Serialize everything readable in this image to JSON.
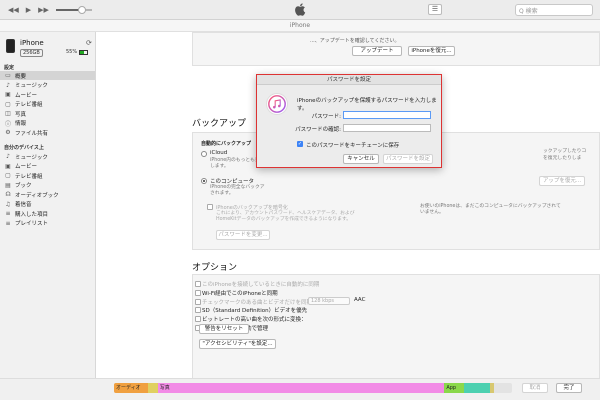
{
  "titlebar": {
    "apple_icon": "apple-logo-icon",
    "search_placeholder": "Q 検索"
  },
  "subbar": {
    "title": "iPhone"
  },
  "sidebar": {
    "device": {
      "name": "iPhone",
      "capacity": "256GB",
      "battery": "55%"
    },
    "settings_title": "設定",
    "settings_items": [
      {
        "icon": "summary-icon",
        "glyph": "▭",
        "label": "概要"
      },
      {
        "icon": "music-icon",
        "glyph": "♪",
        "label": "ミュージック"
      },
      {
        "icon": "movie-icon",
        "glyph": "▣",
        "label": "ムービー"
      },
      {
        "icon": "tv-icon",
        "glyph": "▢",
        "label": "テレビ番組"
      },
      {
        "icon": "photo-icon",
        "glyph": "◫",
        "label": "写真"
      },
      {
        "icon": "info-icon",
        "glyph": "ⓘ",
        "label": "情報"
      },
      {
        "icon": "file-share-icon",
        "glyph": "⚙",
        "label": "ファイル共有"
      }
    ],
    "ondevice_title": "自分のデバイス上",
    "ondevice_items": [
      {
        "icon": "music-icon",
        "glyph": "♪",
        "label": "ミュージック"
      },
      {
        "icon": "movie-icon",
        "glyph": "▣",
        "label": "ムービー"
      },
      {
        "icon": "tv-icon",
        "glyph": "▢",
        "label": "テレビ番組"
      },
      {
        "icon": "book-icon",
        "glyph": "▤",
        "label": "ブック"
      },
      {
        "icon": "audiobook-icon",
        "glyph": "☊",
        "label": "オーディオブック"
      },
      {
        "icon": "ringtone-icon",
        "glyph": "♫",
        "label": "着信音"
      },
      {
        "icon": "purchased-icon",
        "glyph": "≡",
        "label": "購入した項目"
      },
      {
        "icon": "playlist-icon",
        "glyph": "≡",
        "label": "プレイリスト"
      }
    ]
  },
  "main": {
    "top_text": "...、アップデートを確認してください。",
    "update_button": "アップデート",
    "restore_button": "iPhoneを復元...",
    "backup": {
      "heading": "バックアップ",
      "auto_title": "自動的にバックアップ",
      "icloud_label": "iCloud",
      "icloud_desc": [
        "iPhone内のもっとも重要なデータを",
        "します。"
      ],
      "computer_label": "このコンピュータ",
      "computer_desc": [
        "iPhoneの完全なバックア",
        "されます。"
      ],
      "encrypt_label": "iPhoneのバックアップを暗号化",
      "encrypt_desc": [
        "これにより、アカウントパスワード、ヘルスケアデータ、および",
        "HomeKitデータのバックアップを作成できるようになります。"
      ],
      "change_password_button": "パスワードを変更...",
      "right_text_1": "ックアップしたりコ",
      "right_text_2": "を復元したりしま",
      "restore_backup_button": "アップを復元...",
      "right_desc": [
        "お使いのiPhoneは、まだこのコンピュータにバックアップされて",
        "いません。"
      ]
    },
    "options": {
      "heading": "オプション",
      "rows": [
        {
          "label": "このiPhoneを接続しているときに自動的に同期",
          "enabled": false
        },
        {
          "label": "Wi-Fi経由でこのiPhoneと同期",
          "enabled": true
        },
        {
          "label": "チェックマークのある曲とビデオだけを同期",
          "enabled": false
        },
        {
          "label": "SD（Standard Definition）ビデオを優先",
          "enabled": true
        },
        {
          "label": "ビットレートの高い曲を次の形式に変換：",
          "enabled": true
        },
        {
          "label": "音楽とビデオを手動で管理",
          "enabled": true
        }
      ],
      "bitrate_value": "128 kbps",
      "format_value": "AAC",
      "reset_warnings_button": "警告をリセット",
      "accessibility_button": "\"アクセシビリティ\"を設定..."
    }
  },
  "dialog": {
    "title": "パスワードを設定",
    "message": "iPhoneのバックアップを保護するパスワードを入力します。",
    "password_label": "パスワード:",
    "confirm_label": "パスワードの確認:",
    "keychain_label": "このパスワードをキーチェーンに保存",
    "cancel_button": "キャンセル",
    "set_button": "パスワードを設定"
  },
  "storage": {
    "segments": [
      {
        "name": "オーディオ",
        "color": "#f0a040",
        "fraction": 0.085
      },
      {
        "name": "",
        "color": "#e0d060",
        "fraction": 0.025
      },
      {
        "name": "写真",
        "color": "#f28be6",
        "fraction": 0.72
      },
      {
        "name": "App",
        "color": "#8ad84a",
        "fraction": 0.05
      },
      {
        "name": "",
        "color": "#4cd0b0",
        "fraction": 0.065
      },
      {
        "name": "",
        "color": "#d8c870",
        "fraction": 0.01
      }
    ],
    "revert_button": "取消",
    "done_button": "完了"
  },
  "volume_level": 0.72
}
